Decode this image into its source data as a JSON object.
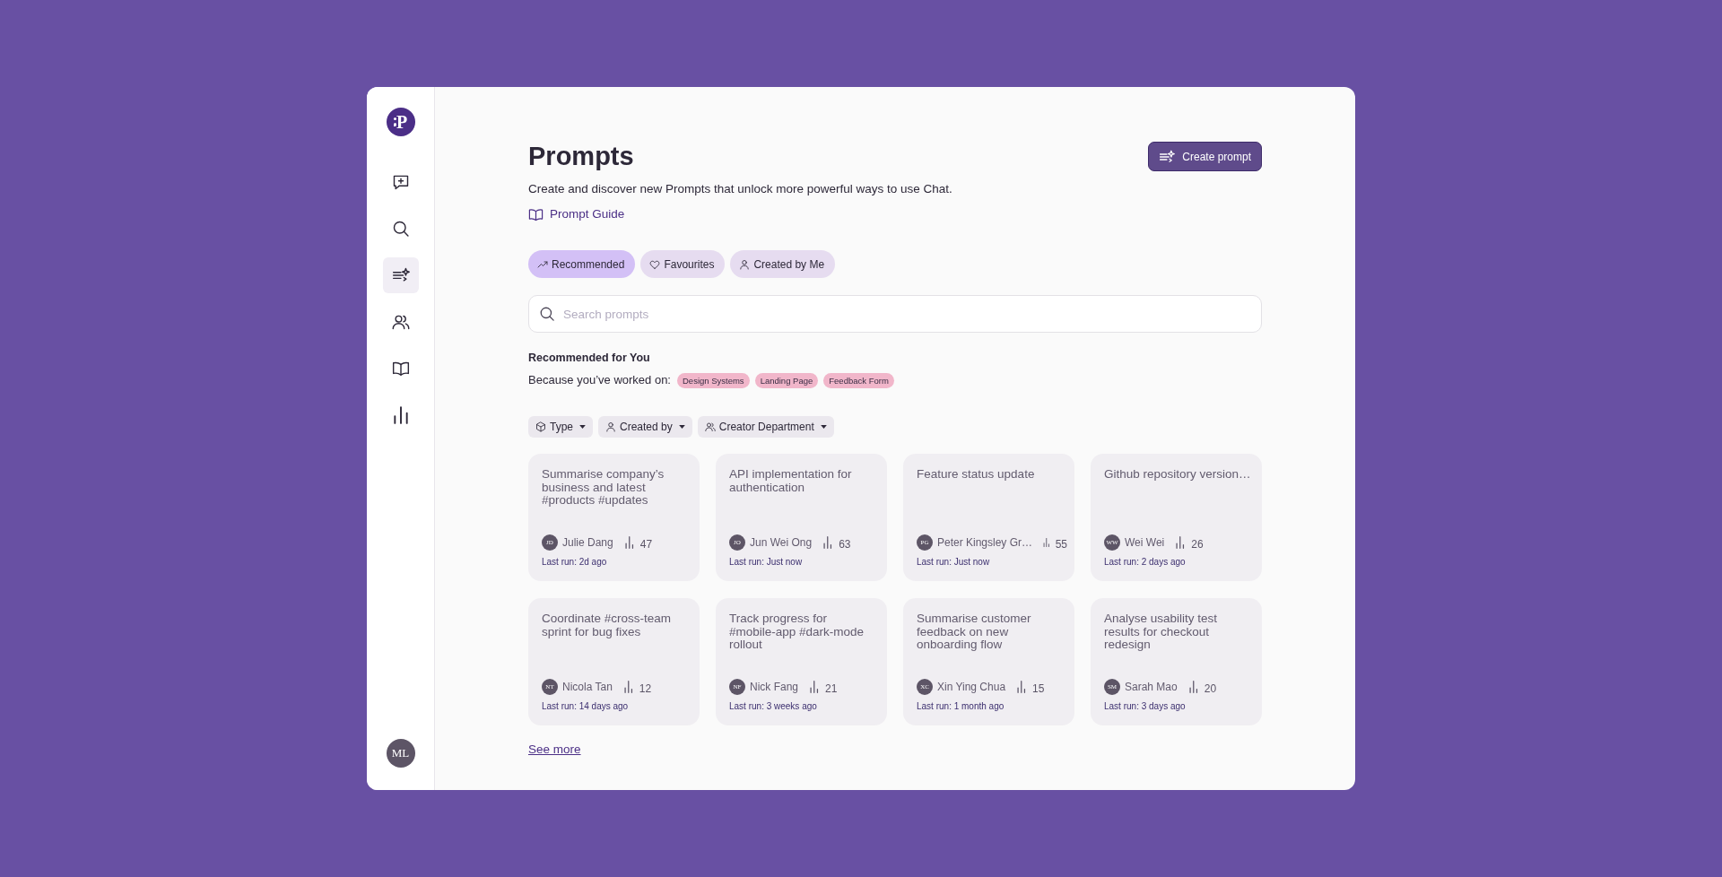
{
  "sidebar": {
    "logo": "P",
    "items": [
      {
        "kind": "chat",
        "selected": false
      },
      {
        "kind": "search",
        "selected": false
      },
      {
        "kind": "prompts",
        "selected": true
      },
      {
        "kind": "people",
        "selected": false
      },
      {
        "kind": "library",
        "selected": false
      },
      {
        "kind": "stats",
        "selected": false
      }
    ],
    "user_initials": "ML"
  },
  "header": {
    "title": "Prompts",
    "create_button": "Create prompt",
    "description": "Create and discover new Prompts that unlock more powerful ways to use Chat.",
    "guide_link": "Prompt Guide"
  },
  "tabs": [
    {
      "label": "Recommended",
      "kind": "trending",
      "selected": true
    },
    {
      "label": "Favourites",
      "kind": "heart",
      "selected": false
    },
    {
      "label": "Created by Me",
      "kind": "person",
      "selected": false
    }
  ],
  "search": {
    "placeholder": "Search prompts"
  },
  "recommended": {
    "heading": "Recommended for You",
    "reason": "Because you’ve worked on:",
    "tags": [
      "Design Systems",
      "Landing Page",
      "Feedback Form"
    ]
  },
  "filters": [
    {
      "label": "Type",
      "kind": "cube"
    },
    {
      "label": "Created by",
      "kind": "person"
    },
    {
      "label": "Creator Department",
      "kind": "people"
    }
  ],
  "cards": [
    {
      "title": "Summarise company’s business and latest #products #updates",
      "initials": "JD",
      "author": "Julie Dang",
      "runs": "47",
      "last_run": "Last run: 2d ago"
    },
    {
      "title": "API implementation for authentication",
      "initials": "JO",
      "author": "Jun Wei Ong",
      "runs": "63",
      "last_run": "Last run: Just now"
    },
    {
      "title": "Feature status update",
      "initials": "PG",
      "author": "Peter Kingsley Gr…",
      "runs": "55",
      "last_run": "Last run: Just now"
    },
    {
      "title": "Github repository version…",
      "initials": "WW",
      "author": "Wei Wei",
      "runs": "26",
      "last_run": "Last run: 2 days ago"
    },
    {
      "title": "Coordinate #cross-team sprint for bug fixes",
      "initials": "NT",
      "author": "Nicola Tan",
      "runs": "12",
      "last_run": "Last run: 14 days ago"
    },
    {
      "title": "Track progress for #mobile-app #dark-mode rollout",
      "initials": "NF",
      "author": "Nick Fang",
      "runs": "21",
      "last_run": "Last run: 3 weeks ago"
    },
    {
      "title": "Summarise customer feedback on new onboarding flow",
      "initials": "XC",
      "author": "Xin Ying Chua",
      "runs": "15",
      "last_run": "Last run: 1 month ago"
    },
    {
      "title": "Analyse usability test results for checkout redesign",
      "initials": "SM",
      "author": "Sarah Mao",
      "runs": "20",
      "last_run": "Last run: 3 days ago"
    }
  ],
  "see_more": "See more"
}
